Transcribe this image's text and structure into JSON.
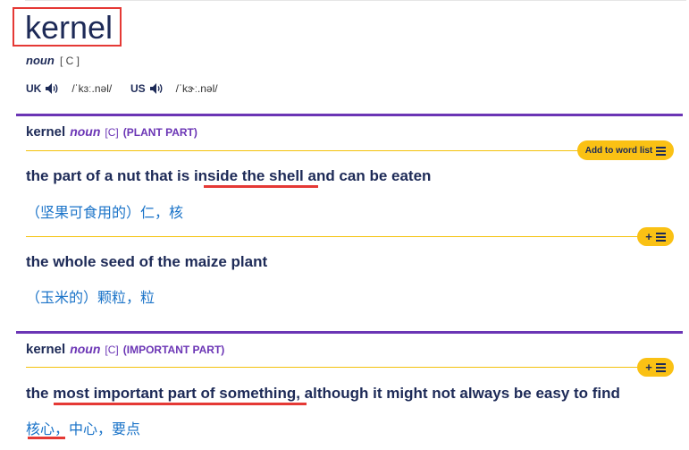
{
  "entry": {
    "headword": "kernel",
    "part_of_speech": "noun",
    "grammar_code": "[ C ]",
    "pronunciations": [
      {
        "region": "UK",
        "ipa": "/ˈkɜː.nəl/"
      },
      {
        "region": "US",
        "ipa": "/ˈkɝː.nəl/"
      }
    ]
  },
  "senses": [
    {
      "headword": "kernel",
      "part_of_speech": "noun",
      "grammar_code": "[C]",
      "guideword": "(PLANT PART)",
      "add_button_label": "Add to word list",
      "definitions": [
        {
          "text_before": "the part of a nut that is ",
          "text_highlight": "inside the shell",
          "text_after": " and can be eaten",
          "translation": "（坚果可食用的）仁，核"
        },
        {
          "text": "the whole seed of the maize plant",
          "translation": "（玉米的）颗粒，粒"
        }
      ]
    },
    {
      "headword": "kernel",
      "part_of_speech": "noun",
      "grammar_code": "[C]",
      "guideword": "(IMPORTANT PART)",
      "definitions": [
        {
          "text_before": "the ",
          "text_highlight": "most important part of something",
          "text_after": ", although it might not always be easy to find",
          "translation_highlight": "核心",
          "translation_rest": "，中心，要点"
        }
      ]
    }
  ],
  "colors": {
    "accent_purple": "#6b35b5",
    "pill_yellow": "#fac114",
    "translation_blue": "#1a73c8",
    "annotation_red": "#e53935"
  },
  "icons": [
    "speaker-icon",
    "plus-icon",
    "list-icon"
  ]
}
